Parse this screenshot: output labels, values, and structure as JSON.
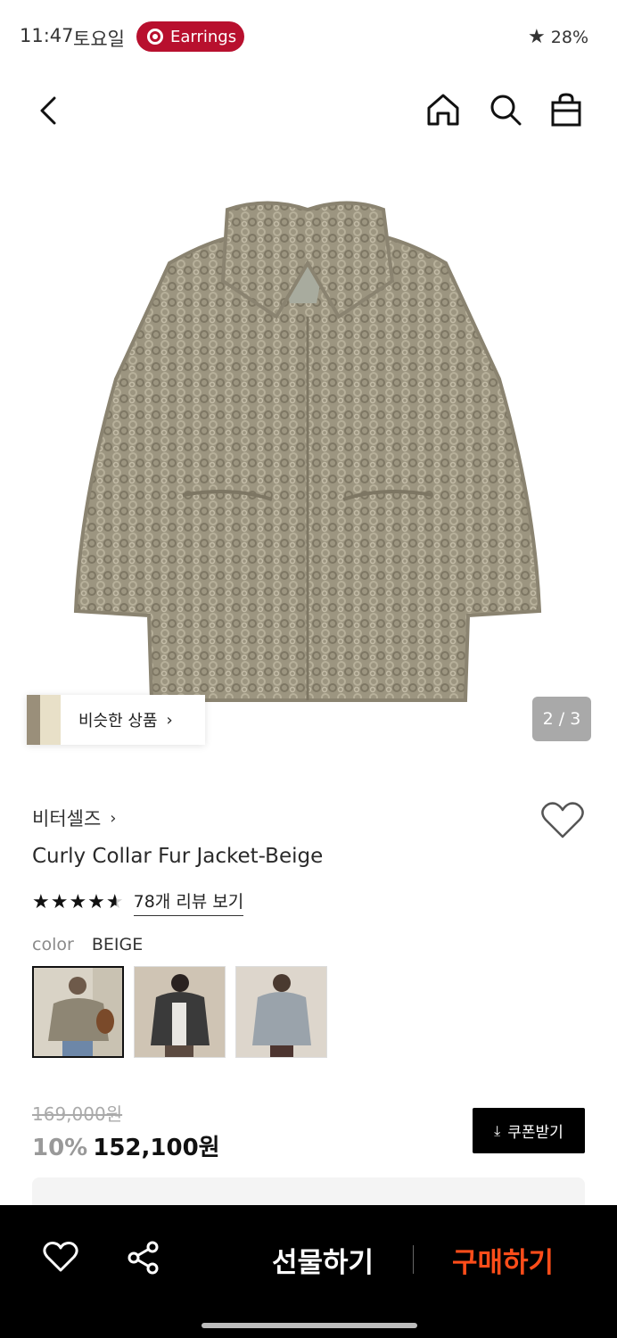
{
  "status_bar": {
    "time": "11:47",
    "day": "토요일",
    "notification": "Earrings",
    "battery": "28%"
  },
  "header": {
    "back_icon": "chevron-left-icon",
    "home_icon": "home-icon",
    "search_icon": "search-icon",
    "bag_icon": "shopping-bag-icon"
  },
  "gallery": {
    "similar_label": "비슷한 상품",
    "page_indicator": "2 / 3"
  },
  "product": {
    "brand": "비터셀즈",
    "title": "Curly Collar Fur Jacket-Beige",
    "rating": 4.5,
    "review_link": "78개 리뷰 보기",
    "color_label": "color",
    "color_value": "BEIGE",
    "swatches": [
      "beige",
      "charcoal",
      "gray"
    ],
    "original_price": "169,000원",
    "discount": "10%",
    "price": "152,100원",
    "coupon_label": "쿠폰받기"
  },
  "bottom_bar": {
    "gift_label": "선물하기",
    "buy_label": "구매하기"
  },
  "colors": {
    "accent": "#ff4d1a",
    "pill": "#b8102e",
    "coat": "#9c9580"
  }
}
